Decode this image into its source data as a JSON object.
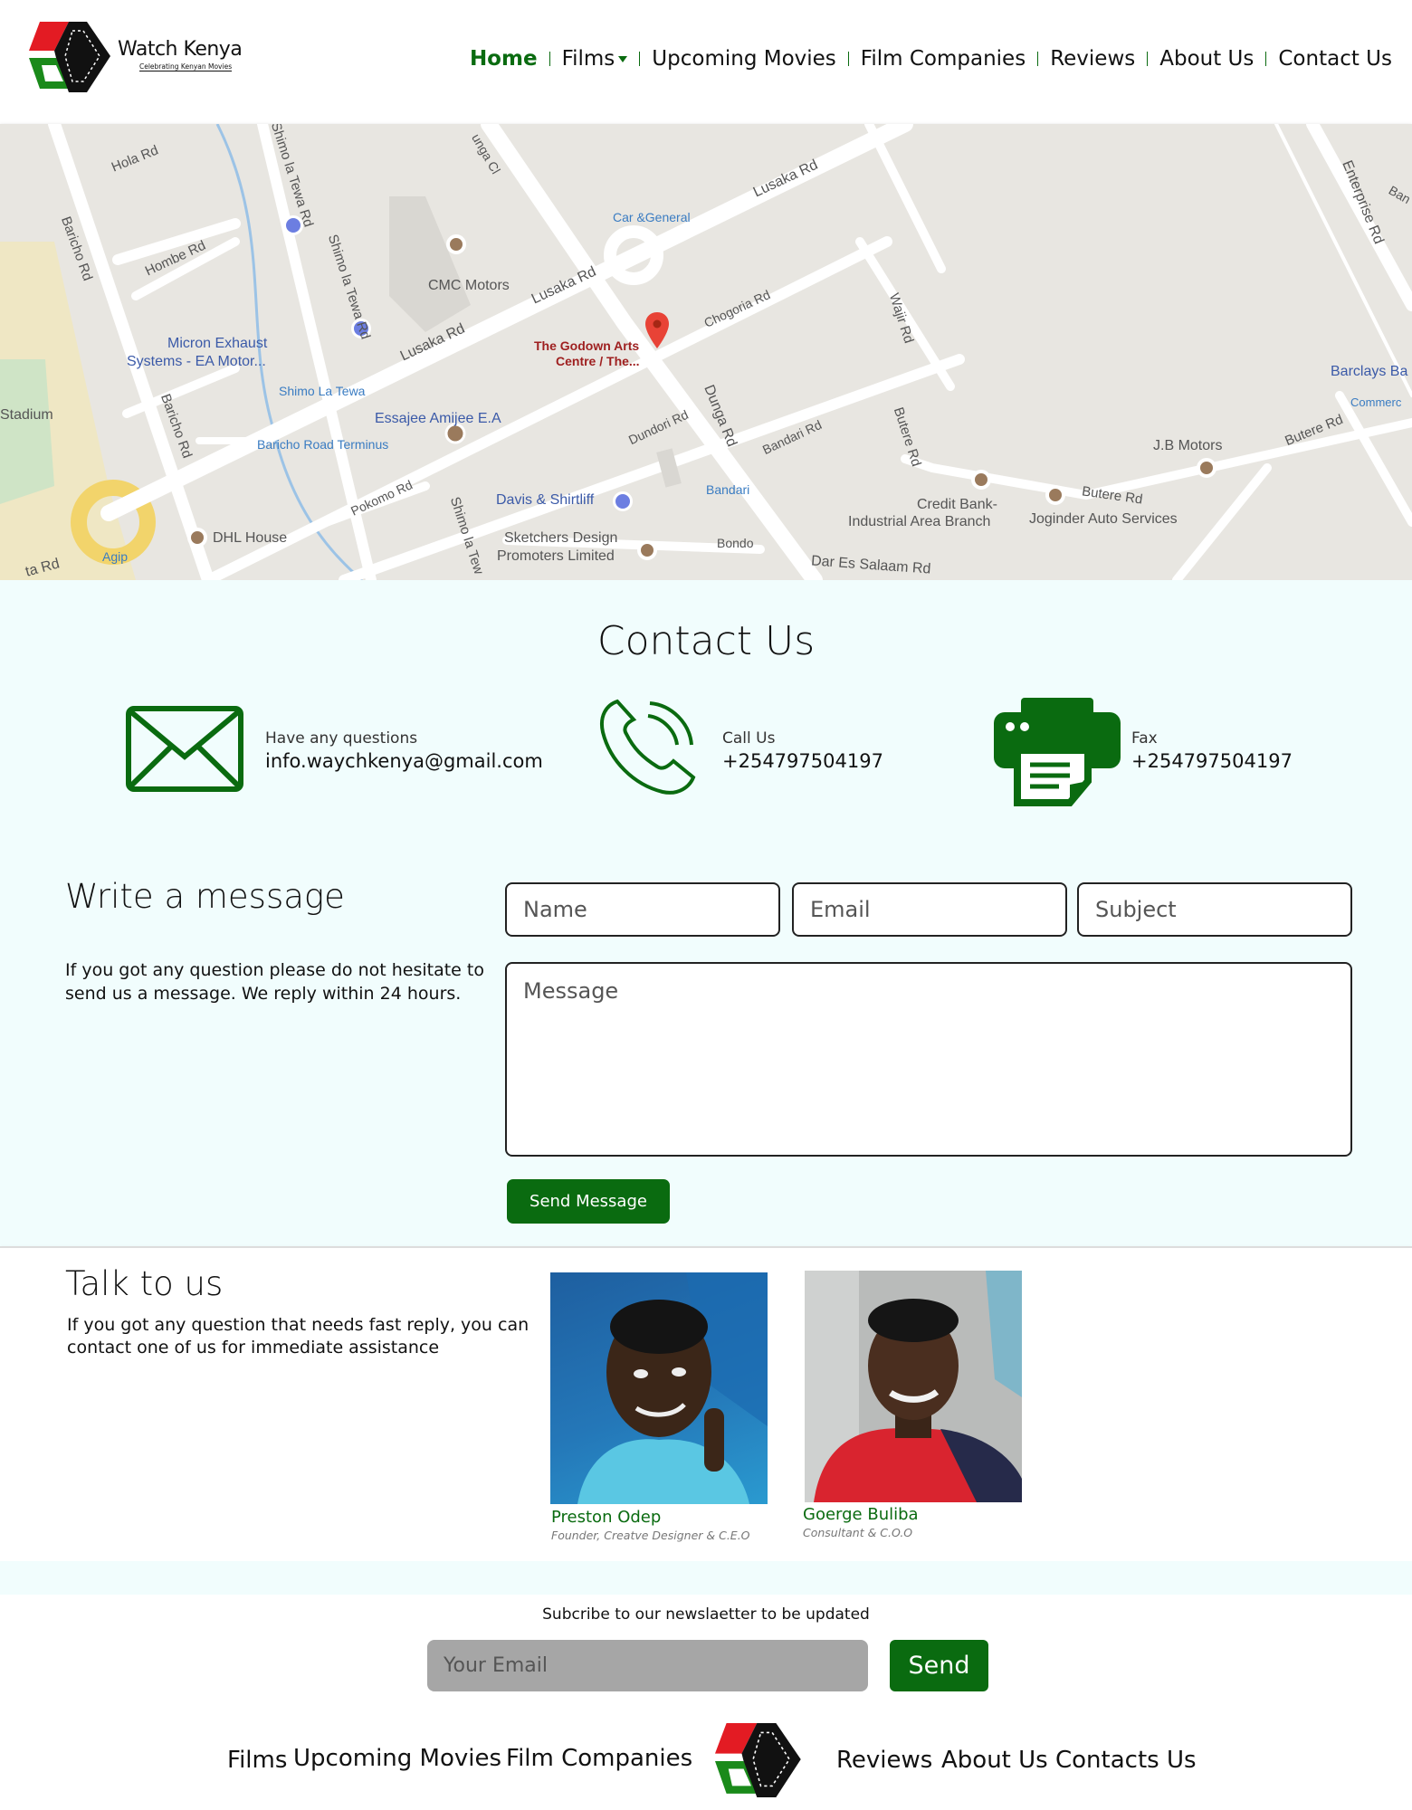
{
  "header": {
    "brand": "Watch Kenya",
    "tagline": "Celebrating Kenyan Movies",
    "nav": [
      {
        "label": "Home",
        "active": true
      },
      {
        "label": "Films",
        "dropdown": true
      },
      {
        "label": "Upcoming Movies"
      },
      {
        "label": "Film Companies"
      },
      {
        "label": "Reviews"
      },
      {
        "label": "About Us"
      },
      {
        "label": "Contact Us"
      }
    ]
  },
  "map": {
    "pin_label_1": "The Godown Arts",
    "pin_label_2": "Centre / The...",
    "labels": {
      "hola": "Hola Rd",
      "baricho1": "Baricho Rd",
      "hombe": "Hombe Rd",
      "shimo1": "Shimo la Tewa Rd",
      "shimo2": "Shimo la Tewa Rd",
      "lusaka1": "Lusaka Rd",
      "lusaka2": "Lusaka Rd",
      "lusaka3": "Lusaka Rd",
      "cmc": "CMC Motors",
      "car": "Car &General",
      "micron1": "Micron Exhaust",
      "micron2": "Systems - EA Motor...",
      "shimolatewa": "Shimo La Tewa",
      "essajee": "Essajee Amijee E.A",
      "stadium": "Stadium",
      "baricho2": "Baricho Rd",
      "bterm": "Baricho Road Terminus",
      "chogoria": "Chogoria Rd",
      "wajir": "Wajir Rd",
      "dunga": "Dunga Rd",
      "dundori": "Dundori Rd",
      "bandari1": "Bandari Rd",
      "bandari2": "Bandari",
      "butere1": "Butere Rd",
      "butere2": "Butere Rd",
      "butere3": "Butere Rd",
      "jb": "J.B Motors",
      "credit1": "Credit Bank-",
      "credit2": "Industrial Area Branch",
      "joginder": "Joginder Auto Services",
      "barclays": "Barclays Ba",
      "commerc": "Commerc",
      "enterprise": "Enterprise Rd",
      "davis": "Davis & Shirtliff",
      "pokomo": "Pokomo Rd",
      "shimo3": "Shimo la Tew",
      "sketch1": "Sketchers Design",
      "sketch2": "Promoters Limited",
      "bondo": "Bondo",
      "dares": "Dar Es Salaam Rd",
      "dhl": "DHL House",
      "agip": "Agip",
      "tard": "ta Rd",
      "dungac": "unga Cl",
      "ban": "Ban"
    }
  },
  "contact": {
    "title": "Contact Us",
    "email": {
      "label": "Have any questions",
      "value": "info.waychkenya@gmail.com"
    },
    "phone": {
      "label": "Call Us",
      "value": "+254797504197"
    },
    "fax": {
      "label": "Fax",
      "value": "+254797504197"
    },
    "form": {
      "heading": "Write a message",
      "description": "If you got any question please do not hesitate to send us a message. We reply within 24 hours.",
      "name_placeholder": "Name",
      "email_placeholder": "Email",
      "subject_placeholder": "Subject",
      "message_placeholder": "Message",
      "submit": "Send Message"
    }
  },
  "talk": {
    "title": "Talk to us",
    "description": "If you got any question that needs fast reply, you can contact one of us for immediate assistance",
    "people": [
      {
        "name": "Preston Odep",
        "role": "Founder, Creatve Designer & C.E.O"
      },
      {
        "name": "Goerge Buliba",
        "role": "Consultant & C.O.O"
      }
    ]
  },
  "footer": {
    "newsletter_text": "Subcribe to our newslaetter to be updated",
    "email_placeholder": "Your Email",
    "send": "Send",
    "links": [
      "Films",
      "Upcoming Movies",
      "Film Companies",
      "Reviews",
      "About Us",
      "Contacts Us"
    ]
  },
  "colors": {
    "accent_green": "#0a6b10",
    "logo_red": "#e31b23",
    "section_bg": "#f1fdfd"
  }
}
